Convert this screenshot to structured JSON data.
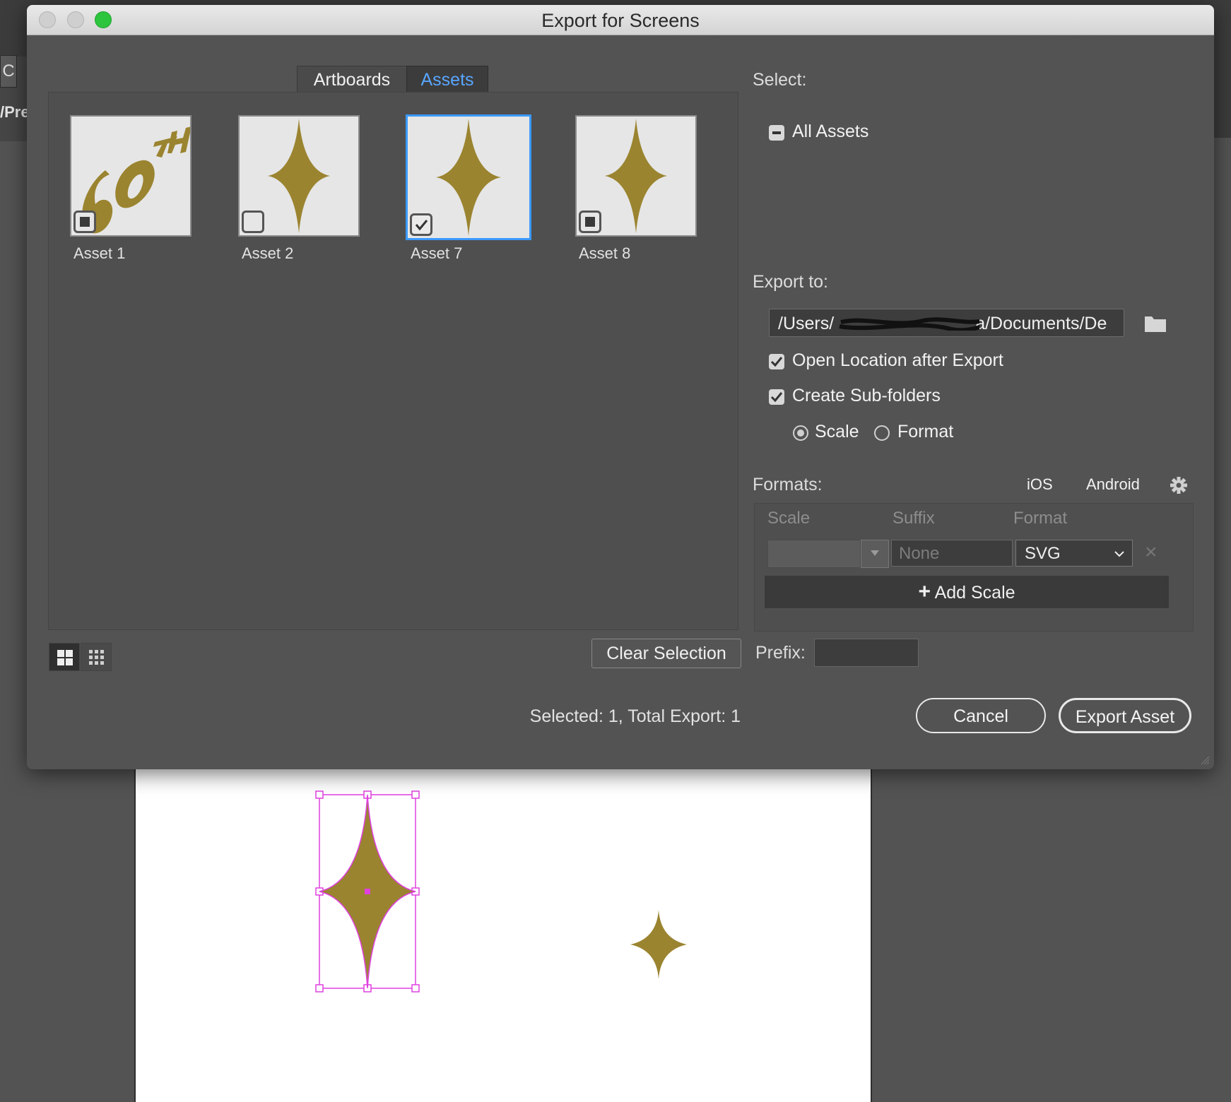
{
  "background": {
    "path_fragment": "/Pre",
    "toolbar_glyph": "C"
  },
  "dialog": {
    "title": "Export for Screens",
    "tabs": [
      {
        "label": "Artboards",
        "active": false
      },
      {
        "label": "Assets",
        "active": true
      }
    ],
    "assets": [
      {
        "name": "Asset 1",
        "checked": false,
        "selected": false,
        "art": "60th-logo"
      },
      {
        "name": "Asset 2",
        "checked": false,
        "selected": false,
        "art": "star"
      },
      {
        "name": "Asset 7",
        "checked": true,
        "selected": true,
        "art": "star"
      },
      {
        "name": "Asset 8",
        "checked": false,
        "selected": false,
        "art": "star"
      }
    ],
    "clear_selection_label": "Clear Selection",
    "status_text": "Selected: 1, Total Export: 1",
    "select": {
      "heading": "Select:",
      "all_assets_label": "All Assets",
      "all_assets_state": "indeterminate"
    },
    "export_to": {
      "heading": "Export to:",
      "path_start": "/Users/",
      "path_end": "a/Documents/De",
      "open_location_label": "Open Location after Export",
      "open_location_checked": true,
      "create_subfolders_label": "Create Sub-folders",
      "create_subfolders_checked": true,
      "subfolder_options": [
        {
          "label": "Scale",
          "selected": true
        },
        {
          "label": "Format",
          "selected": false
        }
      ]
    },
    "formats": {
      "heading": "Formats:",
      "ios_label": "iOS",
      "android_label": "Android",
      "columns": [
        "Scale",
        "Suffix",
        "Format"
      ],
      "row": {
        "scale": "",
        "suffix_placeholder": "None",
        "format": "SVG"
      },
      "add_scale_label": "Add Scale"
    },
    "prefix_label": "Prefix:",
    "prefix_value": "",
    "cancel_label": "Cancel",
    "export_label": "Export Asset"
  },
  "colors": {
    "accent": "#3b99fc",
    "asset_gold": "#9b8430",
    "selection_magenta": "#e040e0",
    "dialog_bg": "#535353"
  }
}
